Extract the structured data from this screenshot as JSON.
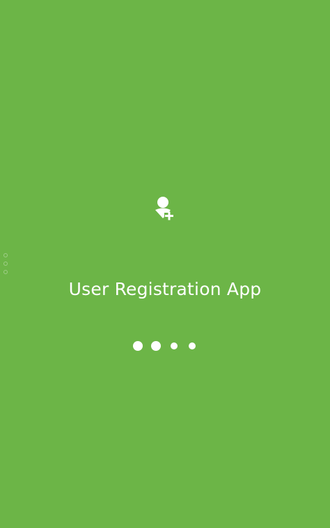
{
  "splash": {
    "background_color": "#6cb547",
    "foreground_color": "#ffffff",
    "logo_icon": "add-user-icon",
    "title": "User Registration App",
    "loader": {
      "dot_count": 4,
      "active_dots": 2
    }
  }
}
